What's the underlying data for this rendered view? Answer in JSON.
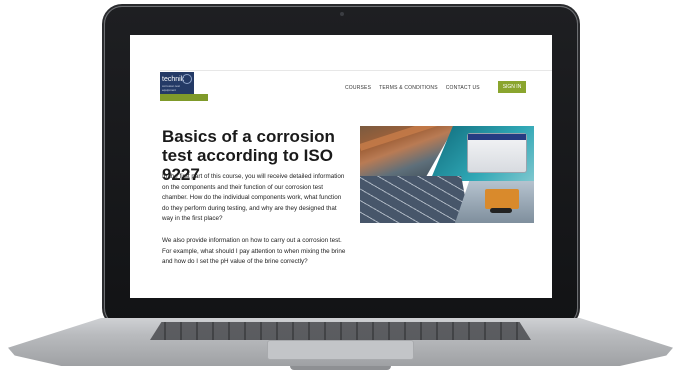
{
  "site": {
    "logo_text": "technik",
    "logo_subtext": "corrosion test equipment"
  },
  "nav": {
    "items": [
      "COURSES",
      "TERMS & CONDITIONS",
      "CONTACT US"
    ],
    "signin_label": "SIGN IN"
  },
  "content": {
    "title": "Basics of a corrosion test according to ISO 9227",
    "paragraph1": "In the first part of this course, you will receive detailed information on the components and their function of our corrosion test chamber. How do the individual components work, what function do they perform during testing, and why are they designed that way in the first place?",
    "paragraph2": "We also provide information on how to carry out a corrosion test. For example, what should I pay attention to when mixing the brine and how do I set the pH value of the brine correctly?"
  },
  "colors": {
    "accent_green": "#8aa52e",
    "logo_blue": "#243a66"
  }
}
